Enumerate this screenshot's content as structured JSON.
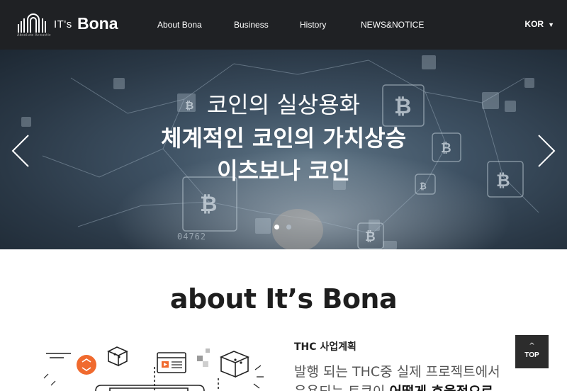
{
  "header": {
    "logo": {
      "prefix": "IT's",
      "name": "Bona",
      "tagline": "Absolute Acoustic"
    },
    "nav": [
      "About Bona",
      "Business",
      "History",
      "NEWS&NOTICE"
    ],
    "language": "KOR"
  },
  "hero": {
    "line1": "코인의 실상용화",
    "line2": "체계적인 코인의 가치상승",
    "line3": "이츠보나 코인",
    "background_number": "04762",
    "slides_total": 2,
    "active_slide": 1
  },
  "about": {
    "title": "about It’s Bona",
    "subtitle": "THC 사업계획",
    "body_line1": "발행 되는 THC중 실제 프로젝트에서",
    "body_line2_prefix": "운용되는 토큰이 ",
    "body_line2_bold": "어떻게 효율적으로"
  },
  "top_button": {
    "label": "TOP"
  },
  "colors": {
    "header_bg": "#1f2124",
    "hero_overlay": "#3e5163",
    "accent_orange": "#f06a2e"
  }
}
